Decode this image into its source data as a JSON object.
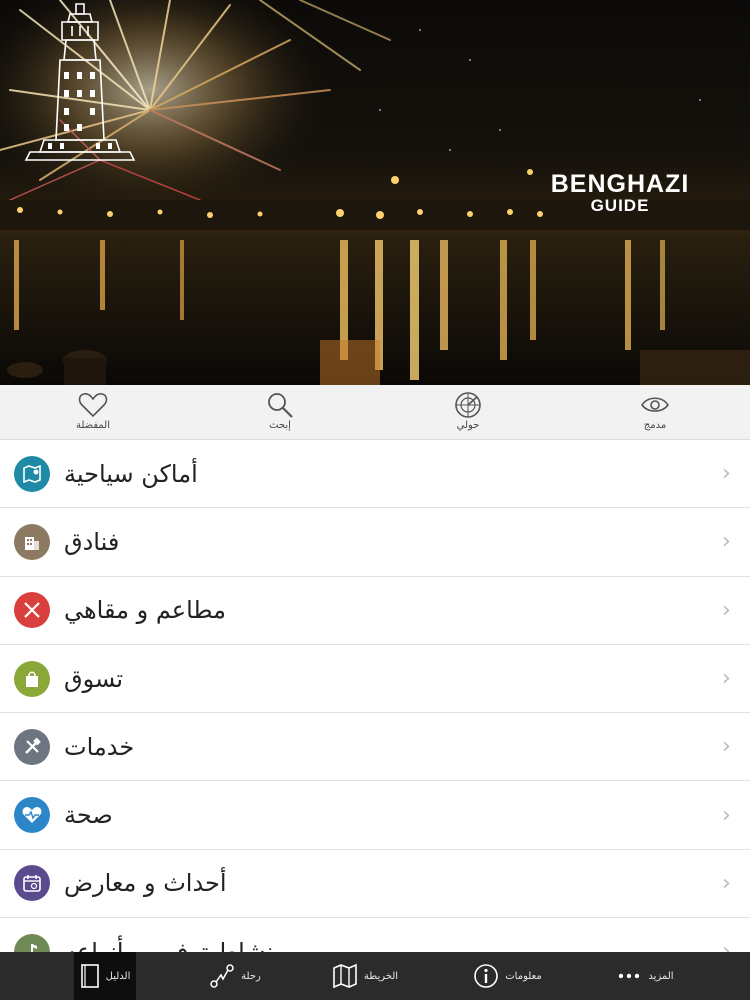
{
  "hero": {
    "logo_title": "BENGHAZI",
    "logo_subtitle": "GUIDE"
  },
  "toolbar": {
    "items": [
      {
        "label": "المفضلة",
        "icon": "heart-icon"
      },
      {
        "label": "إبحث",
        "icon": "search-icon"
      },
      {
        "label": "حولي",
        "icon": "radar-icon"
      },
      {
        "label": "مدمج",
        "icon": "eye-icon"
      }
    ]
  },
  "menu": {
    "items": [
      {
        "label": "أماكن سياحية",
        "icon": "map-icon",
        "color": "#1e8aa6"
      },
      {
        "label": "فنادق",
        "icon": "building-icon",
        "color": "#8c7a62"
      },
      {
        "label": "مطاعم و مقاهي",
        "icon": "cutlery-icon",
        "color": "#d9403d"
      },
      {
        "label": "تسوق",
        "icon": "shopping-bag-icon",
        "color": "#8aa83a"
      },
      {
        "label": "خدمات",
        "icon": "tools-icon",
        "color": "#6c7580"
      },
      {
        "label": "صحة",
        "icon": "heartbeat-icon",
        "color": "#2d86c9"
      },
      {
        "label": "أحداث و معارض",
        "icon": "calendar-icon",
        "color": "#5b4a8e"
      },
      {
        "label": "نشاط ترفيهي بأنواعه",
        "icon": "music-icon",
        "color": "#6f8a54"
      }
    ],
    "chevron": "›"
  },
  "tabbar": {
    "tabs": [
      {
        "label": "الدليل",
        "icon": "book-icon",
        "active": true
      },
      {
        "label": "رحلة",
        "icon": "route-icon",
        "active": false
      },
      {
        "label": "الخريطة",
        "icon": "map-icon",
        "active": false
      },
      {
        "label": "معلومات",
        "icon": "info-icon",
        "active": false
      },
      {
        "label": "المزيد",
        "icon": "more-dots-icon",
        "active": false
      }
    ]
  }
}
